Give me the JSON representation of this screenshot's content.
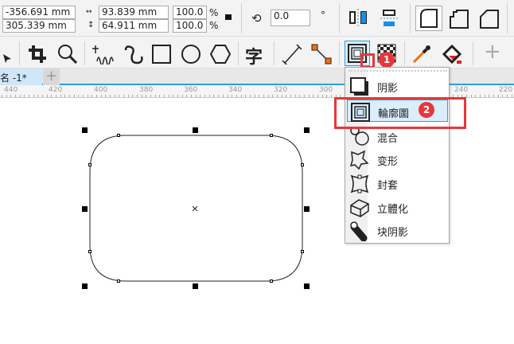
{
  "property_bar": {
    "x": "-356.691 mm",
    "y": "305.339 mm",
    "width": "93.839 mm",
    "height": "64.911 mm",
    "scale_x": "100.0",
    "scale_y": "100.0",
    "percent": "%",
    "rotation": "0.0",
    "degree": "°"
  },
  "document_tab": {
    "label": "名 -1*",
    "add": "+"
  },
  "ruler": {
    "labels": [
      "440",
      "420",
      "400",
      "380",
      "360",
      "340",
      "320",
      "300",
      "240",
      "220"
    ]
  },
  "effects_menu": {
    "items": [
      {
        "label": "阴影",
        "icon": "drop-shadow-icon"
      },
      {
        "label": "輪廓圖",
        "icon": "contour-icon",
        "selected": true
      },
      {
        "label": "混合",
        "icon": "blend-icon"
      },
      {
        "label": "变形",
        "icon": "distort-icon"
      },
      {
        "label": "封套",
        "icon": "envelope-icon"
      },
      {
        "label": "立體化",
        "icon": "extrude-icon"
      },
      {
        "label": "块阴影",
        "icon": "block-shadow-icon"
      }
    ]
  },
  "annotations": {
    "step1": "1",
    "step2": "2",
    "color": "#e8373a"
  },
  "toolbox": {
    "add": "+",
    "text_tool": "字"
  }
}
